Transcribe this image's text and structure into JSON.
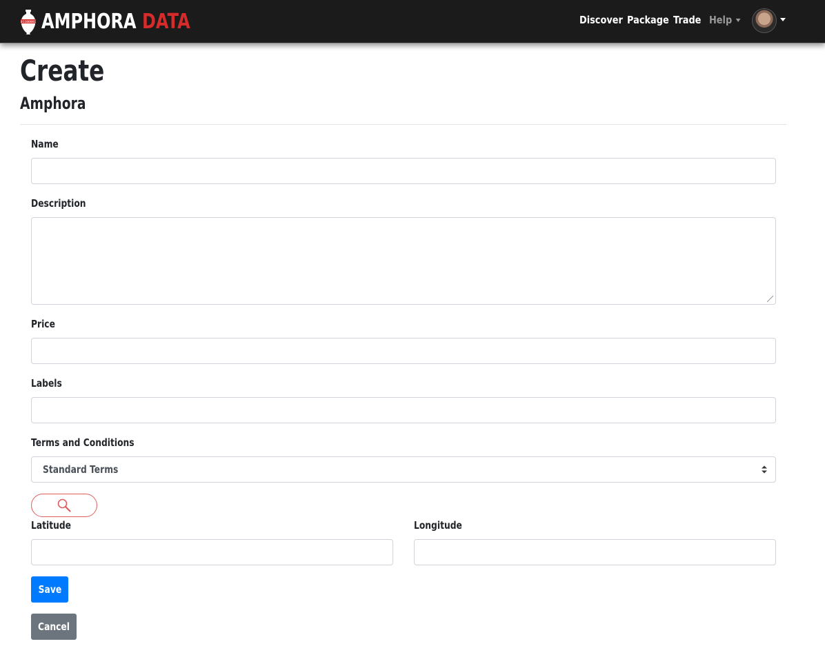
{
  "brand": {
    "name_part1": "AMPHORA",
    "name_part2": "DATA",
    "icon": "amphora-logo-icon",
    "badge": "01100001",
    "accent_color": "#d52b2b"
  },
  "nav": {
    "items": [
      {
        "label": "Discover"
      },
      {
        "label": "Package"
      },
      {
        "label": "Trade"
      },
      {
        "label": "Help"
      }
    ],
    "avatar": "user-avatar"
  },
  "page": {
    "title": "Create",
    "subtitle": "Amphora"
  },
  "form": {
    "name_label": "Name",
    "name_value": "",
    "description_label": "Description",
    "description_value": "",
    "price_label": "Price",
    "price_value": "",
    "labels_label": "Labels",
    "labels_value": "",
    "terms_label": "Terms and Conditions",
    "terms_selected": "Standard Terms",
    "search_icon": "search-icon",
    "latitude_label": "Latitude",
    "latitude_value": "",
    "longitude_label": "Longitude",
    "longitude_value": ""
  },
  "actions": {
    "save_label": "Save",
    "cancel_label": "Cancel",
    "save_color": "#007bff",
    "cancel_color": "#6c757d"
  }
}
